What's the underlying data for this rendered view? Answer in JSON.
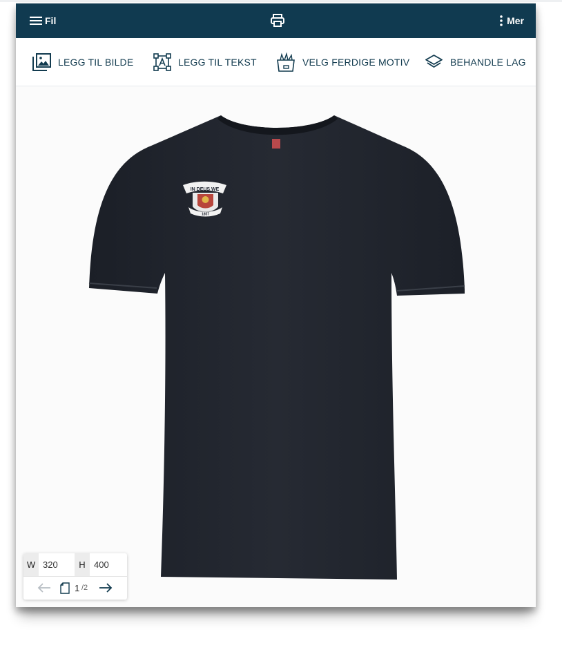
{
  "topbar": {
    "file_label": "Fil",
    "more_label": "Mer",
    "icons": {
      "menu": "hamburger-icon",
      "print": "printer-icon",
      "more": "vertical-dots-icon"
    },
    "background": "#103a50"
  },
  "toolbar": {
    "items": [
      {
        "label": "LEGG TIL BILDE",
        "icon": "add-image-icon"
      },
      {
        "label": "LEGG TIL TEKST",
        "icon": "add-text-icon"
      },
      {
        "label": "VELG FERDIGE MOTIV",
        "icon": "clipart-box-icon"
      },
      {
        "label": "BEHANDLE LAG",
        "icon": "layers-icon"
      }
    ]
  },
  "canvas": {
    "product": "black t-shirt",
    "print_motif": {
      "text_top": "IN DEUS WE",
      "text_bottom": "1857"
    }
  },
  "dimensions": {
    "width_label": "W",
    "width_value": "320",
    "height_label": "H",
    "height_value": "400"
  },
  "pager": {
    "current": "1",
    "total": "/2"
  }
}
